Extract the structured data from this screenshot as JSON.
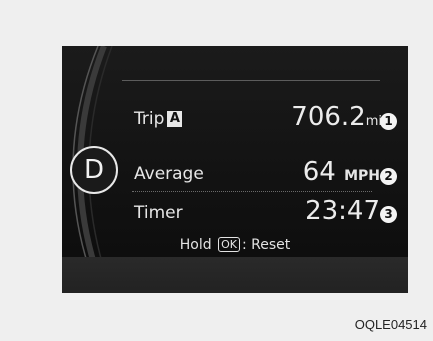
{
  "gear": "D",
  "rows": {
    "trip": {
      "label": "Trip",
      "badge": "A",
      "value": "706.2",
      "unit": "mi",
      "marker": "1"
    },
    "average": {
      "label": "Average",
      "value": "64",
      "unit": "MPH",
      "marker": "2"
    },
    "timer": {
      "label": "Timer",
      "value": "23:47",
      "marker": "3"
    }
  },
  "footer": {
    "hold": "Hold",
    "key": "OK",
    "action": ": Reset"
  },
  "caption": "OQLE04514",
  "colors": {
    "screen": "#121212",
    "text": "#ececec",
    "page": "#efefef"
  }
}
